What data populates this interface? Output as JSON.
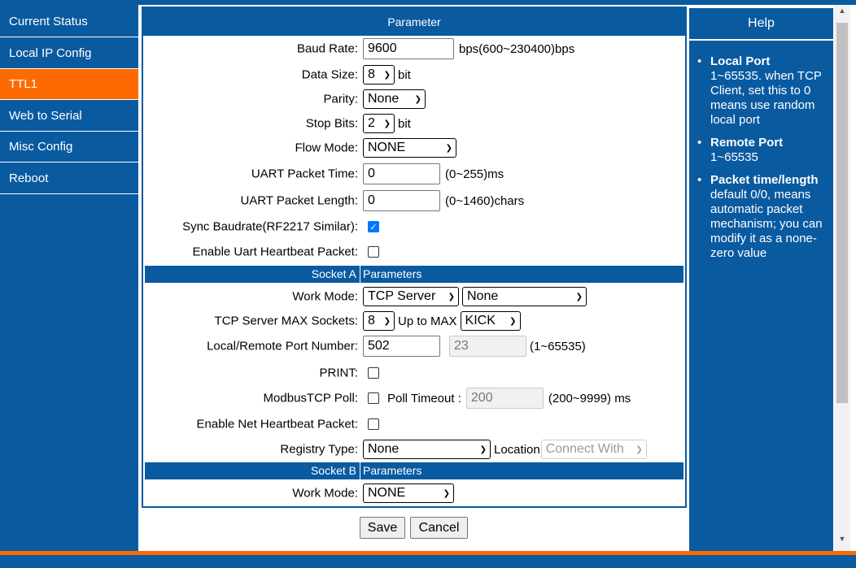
{
  "sidebar": {
    "items": [
      {
        "label": "Current Status"
      },
      {
        "label": "Local IP Config"
      },
      {
        "label": "TTL1"
      },
      {
        "label": "Web to Serial"
      },
      {
        "label": "Misc Config"
      },
      {
        "label": "Reboot"
      }
    ],
    "active": "TTL1"
  },
  "panel": {
    "title": "Parameter",
    "baud_rate": {
      "label": "Baud Rate:",
      "value": "9600",
      "hint": "bps(600~230400)bps"
    },
    "data_size": {
      "label": "Data Size:",
      "value": "8",
      "unit": "bit"
    },
    "parity": {
      "label": "Parity:",
      "value": "None"
    },
    "stop_bits": {
      "label": "Stop Bits:",
      "value": "2",
      "unit": "bit"
    },
    "flow_mode": {
      "label": "Flow Mode:",
      "value": "NONE"
    },
    "uart_packet_time": {
      "label": "UART Packet Time:",
      "value": "0",
      "hint": "(0~255)ms"
    },
    "uart_packet_length": {
      "label": "UART Packet Length:",
      "value": "0",
      "hint": "(0~1460)chars"
    },
    "sync_baudrate": {
      "label": "Sync Baudrate(RF2217 Similar):",
      "checked": true
    },
    "uart_heartbeat": {
      "label": "Enable Uart Heartbeat Packet:",
      "checked": false
    },
    "socket_a": {
      "header_left": "Socket A",
      "header_right": "Parameters",
      "work_mode": {
        "label": "Work Mode:",
        "value": "TCP Server",
        "value2": "None"
      },
      "max_sockets": {
        "label": "TCP Server MAX Sockets:",
        "value": "8",
        "up_to": "Up to MAX",
        "action": "KICK"
      },
      "port_number": {
        "label": "Local/Remote Port Number:",
        "local": "502",
        "remote": "23",
        "hint": "(1~65535)"
      },
      "print": {
        "label": "PRINT:",
        "checked": false
      },
      "modbus_poll": {
        "label": "ModbusTCP Poll:",
        "checked": false,
        "timeout_label": "Poll Timeout :",
        "timeout_value": "200",
        "hint": "(200~9999) ms"
      },
      "net_heartbeat": {
        "label": "Enable Net Heartbeat Packet:",
        "checked": false
      },
      "registry_type": {
        "label": "Registry Type:",
        "value": "None",
        "location_label": "Location",
        "location_value": "Connect With"
      }
    },
    "socket_b": {
      "header_left": "Socket B",
      "header_right": "Parameters",
      "work_mode": {
        "label": "Work Mode:",
        "value": "NONE"
      }
    }
  },
  "buttons": {
    "save": "Save",
    "cancel": "Cancel"
  },
  "help": {
    "title": "Help",
    "items": [
      {
        "bullet": "•",
        "term": "Local Port",
        "text": "1~65535. when TCP Client, set this to 0 means use random local port"
      },
      {
        "bullet": "•",
        "term": "Remote Port",
        "text": "1~65535"
      },
      {
        "bullet": "•",
        "term": "Packet time/length",
        "text": "default 0/0, means automatic packet mechanism; you can modify it as a none-zero value"
      }
    ]
  },
  "scrollbar": {
    "up_glyph": "▲",
    "down_glyph": "▼"
  },
  "colors": {
    "brand_blue": "#0a5aa0",
    "accent_orange": "#ff6a00",
    "checkbox_blue": "#0075ff"
  }
}
